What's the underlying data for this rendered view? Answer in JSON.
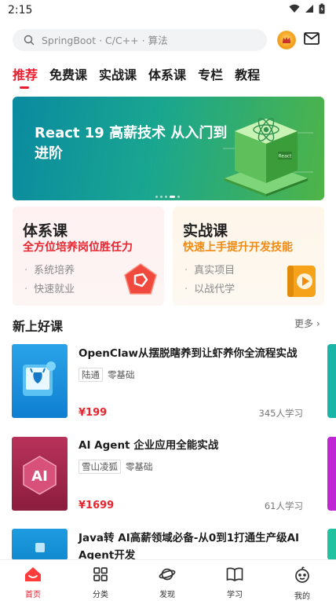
{
  "status": {
    "time": "2:15"
  },
  "search": {
    "placeholder": "SpringBoot · C/C++ · 算法"
  },
  "header": {
    "avatar_icon": "crown-avatar-icon",
    "mail_icon": "mail-icon"
  },
  "tabs": [
    {
      "label": "推荐",
      "active": true
    },
    {
      "label": "免费课"
    },
    {
      "label": "实战课"
    },
    {
      "label": "体系课"
    },
    {
      "label": "专栏"
    },
    {
      "label": "教程"
    }
  ],
  "banner": {
    "title": "React 19 高薪技术 从入门到进阶",
    "badge_text": "React",
    "active_dot": 4,
    "dot_count": 5
  },
  "cards": {
    "left": {
      "title": "体系课",
      "subtitle": "全方位培养岗位胜任力",
      "bullets": [
        "系统培养",
        "快速就业"
      ],
      "color": "#e8242f"
    },
    "right": {
      "title": "实战课",
      "subtitle": "快速上手提升开发技能",
      "bullets": [
        "真实项目",
        "以战代学"
      ],
      "color": "#f28a10"
    }
  },
  "section": {
    "title": "新上好课",
    "more": "更多 ›"
  },
  "courses": [
    {
      "title": "OpenClaw从摆脱瞎养到让虾养你全流程实战",
      "teacher": "陆通",
      "level": "零基础",
      "price": "¥199",
      "learners": "345人学习"
    },
    {
      "title": "AI Agent 企业应用全能实战",
      "teacher": "雪山凌狐",
      "level": "零基础",
      "price": "¥1699",
      "learners": "61人学习",
      "thumb_text": "AI"
    },
    {
      "title": "Java转 AI高薪领域必备-从0到1打通生产级AI Agent开发"
    }
  ],
  "bottom_nav": [
    {
      "label": "首页",
      "icon": "home-icon",
      "active": true
    },
    {
      "label": "分类",
      "icon": "grid-icon"
    },
    {
      "label": "发现",
      "icon": "planet-icon"
    },
    {
      "label": "学习",
      "icon": "book-icon"
    },
    {
      "label": "我的",
      "icon": "profile-icon"
    }
  ],
  "accent": "#ea1b2c"
}
